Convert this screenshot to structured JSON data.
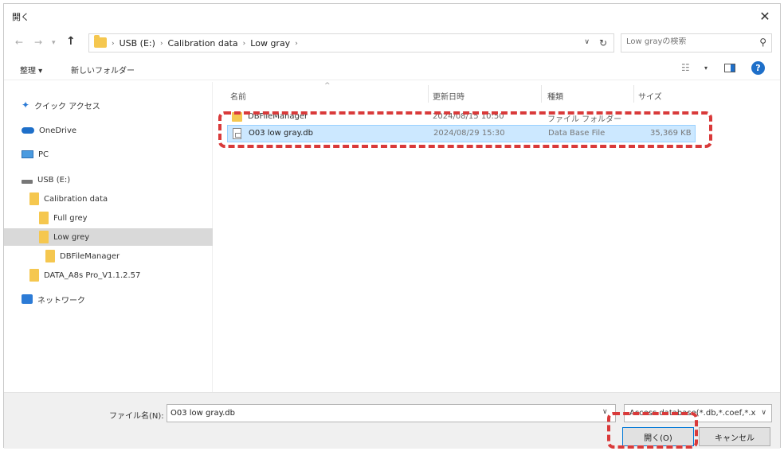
{
  "window": {
    "title": "開く",
    "close_glyph": "✕"
  },
  "nav": {
    "back_glyph": "←",
    "forward_glyph": "→",
    "up_glyph": "↑",
    "breadcrumbs": [
      "USB (E:)",
      "Calibration data",
      "Low gray"
    ],
    "search_placeholder": "Low grayの検索",
    "search_icon": "search-icon"
  },
  "toolbar": {
    "organize": "整理 ▾",
    "new_folder": "新しいフォルダー"
  },
  "sidebar": {
    "items": [
      {
        "label": "クイック アクセス",
        "icon": "star-icon"
      },
      {
        "label": "OneDrive",
        "icon": "cloud-icon"
      },
      {
        "label": "PC",
        "icon": "pc-icon"
      },
      {
        "label": "USB (E:)",
        "icon": "usb-drive-icon"
      },
      {
        "label": "Calibration data",
        "icon": "folder-icon"
      },
      {
        "label": "Full grey",
        "icon": "folder-icon"
      },
      {
        "label": "Low grey",
        "icon": "folder-icon",
        "selected": true
      },
      {
        "label": "DBFileManager",
        "icon": "folder-icon"
      },
      {
        "label": "DATA_A8s Pro_V1.1.2.57",
        "icon": "folder-icon"
      },
      {
        "label": "ネットワーク",
        "icon": "network-icon"
      }
    ]
  },
  "columns": {
    "name": "名前",
    "date": "更新日時",
    "type": "種類",
    "size": "サイズ"
  },
  "files": [
    {
      "name": "DBFileManager",
      "date": "2024/08/15 10:50",
      "type": "ファイル フォルダー",
      "size": "",
      "icon": "folder-icon"
    },
    {
      "name": "O03 low gray.db",
      "date": "2024/08/29 15:30",
      "type": "Data Base File",
      "size": "35,369 KB",
      "icon": "db-file-icon",
      "selected": true
    }
  ],
  "bottom": {
    "filename_label": "ファイル名(N):",
    "filename_value": "O03 low gray.db",
    "file_type": "Access database(*.db,*.coef,*.xls)",
    "open_label": "開く(O)",
    "cancel_label": "キャンセル"
  },
  "colors": {
    "accent": "#1e6fc9",
    "highlight": "#d93a3a",
    "selection": "#cce8ff",
    "folder": "#f5c74f"
  }
}
